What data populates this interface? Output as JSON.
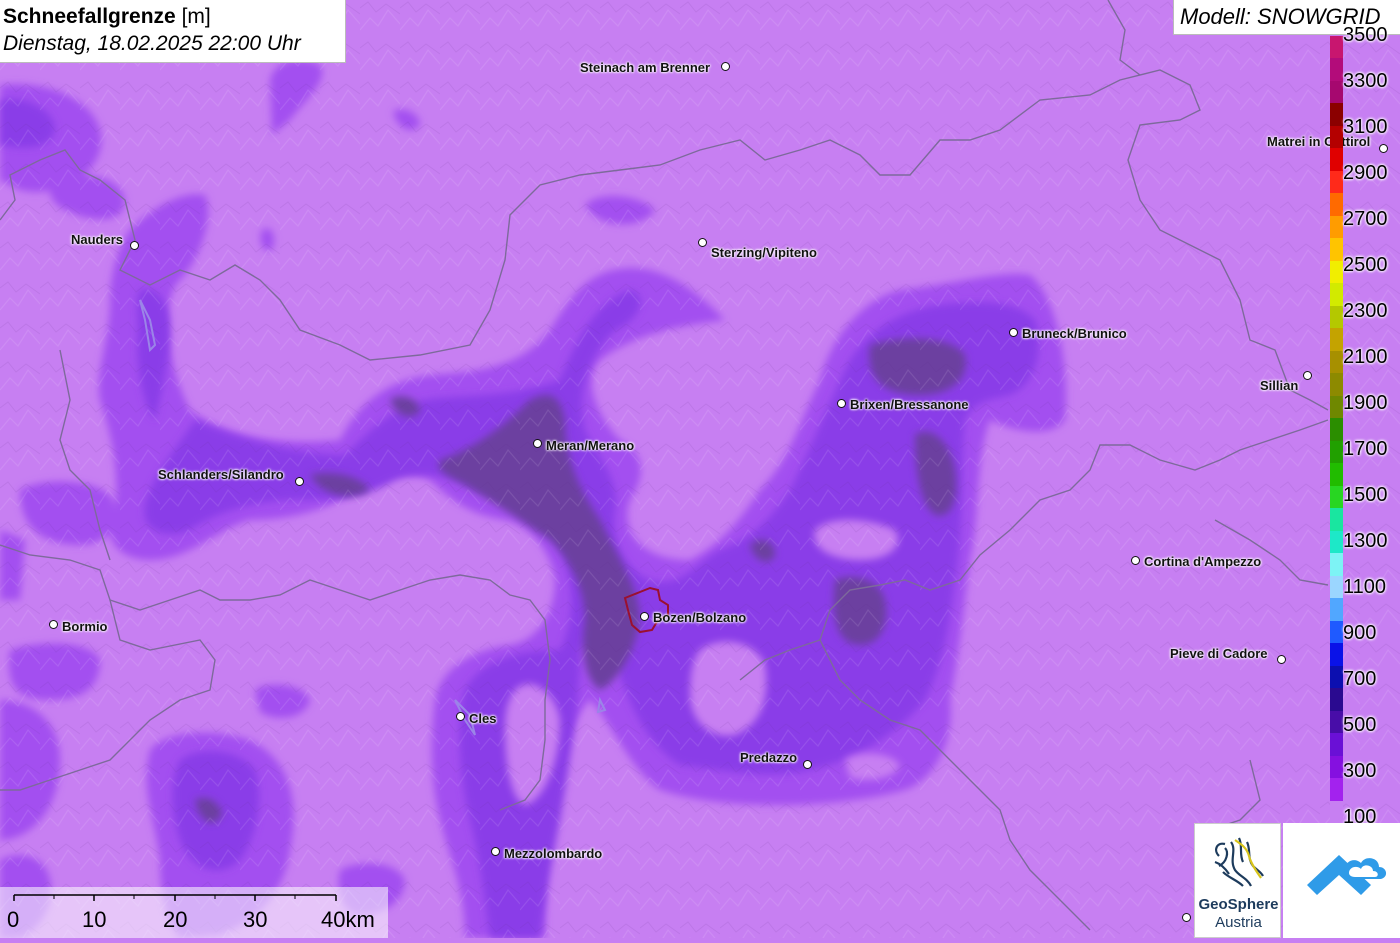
{
  "title": {
    "label_bold": "Schneefallgrenze",
    "label_unit": " [m]",
    "datetime": "Dienstag, 18.02.2025 22:00 Uhr"
  },
  "model": "Modell: SNOWGRID",
  "cities": [
    {
      "name": "Steinach am Brenner"
    },
    {
      "name": "Matrei in Osttirol"
    },
    {
      "name": "Nauders"
    },
    {
      "name": "Sterzing/Vipiteno"
    },
    {
      "name": "Bruneck/Brunico"
    },
    {
      "name": "Sillian"
    },
    {
      "name": "Brixen/Bressanone"
    },
    {
      "name": "Meran/Merano"
    },
    {
      "name": "Schlanders/Silandro"
    },
    {
      "name": "Cortina d'Ampezzo"
    },
    {
      "name": "Bormio"
    },
    {
      "name": "Bozen/Bolzano"
    },
    {
      "name": "Pieve di Cadore"
    },
    {
      "name": "Cles"
    },
    {
      "name": "Predazzo"
    },
    {
      "name": "Mezzolombardo"
    }
  ],
  "legend": {
    "labels": [
      "3500",
      "3300",
      "3100",
      "2900",
      "2700",
      "2500",
      "2300",
      "2100",
      "1900",
      "1700",
      "1500",
      "1300",
      "1100",
      "900",
      "700",
      "500",
      "300",
      "100"
    ],
    "colors": [
      "#c8166f",
      "#b30c7a",
      "#a6086f",
      "#8b0000",
      "#b40000",
      "#e00000",
      "#ff2a1a",
      "#ff6a00",
      "#ff9c00",
      "#ffc400",
      "#f1ee00",
      "#d2ea00",
      "#b4c800",
      "#c4a300",
      "#a79000",
      "#8d8a00",
      "#6f8800",
      "#2b8e00",
      "#21a000",
      "#21bc00",
      "#28d622",
      "#19e6a0",
      "#1de8c8",
      "#7df3f5",
      "#9bd6ff",
      "#51a7ff",
      "#1f5aff",
      "#0a12e8",
      "#0c0fb0",
      "#2a0a90",
      "#480da8",
      "#6a10d6",
      "#8510e0",
      "#a322ee",
      "#c77ff2"
    ]
  },
  "scalebar": {
    "labels": [
      "0",
      "10",
      "20",
      "30",
      "40km"
    ]
  },
  "logos": {
    "geosphere_line1": "GeoSphere",
    "geosphere_line2": "Austria"
  },
  "palette": {
    "bg": "#c77ff2",
    "zone_300": "#a34ff0",
    "zone_500": "#8a3ee8",
    "zone_low": "#7a3ad0",
    "zone_dark": "#6c3fa0",
    "border_line": "#7d6a9b",
    "bolzano_outline": "#9b1030"
  }
}
